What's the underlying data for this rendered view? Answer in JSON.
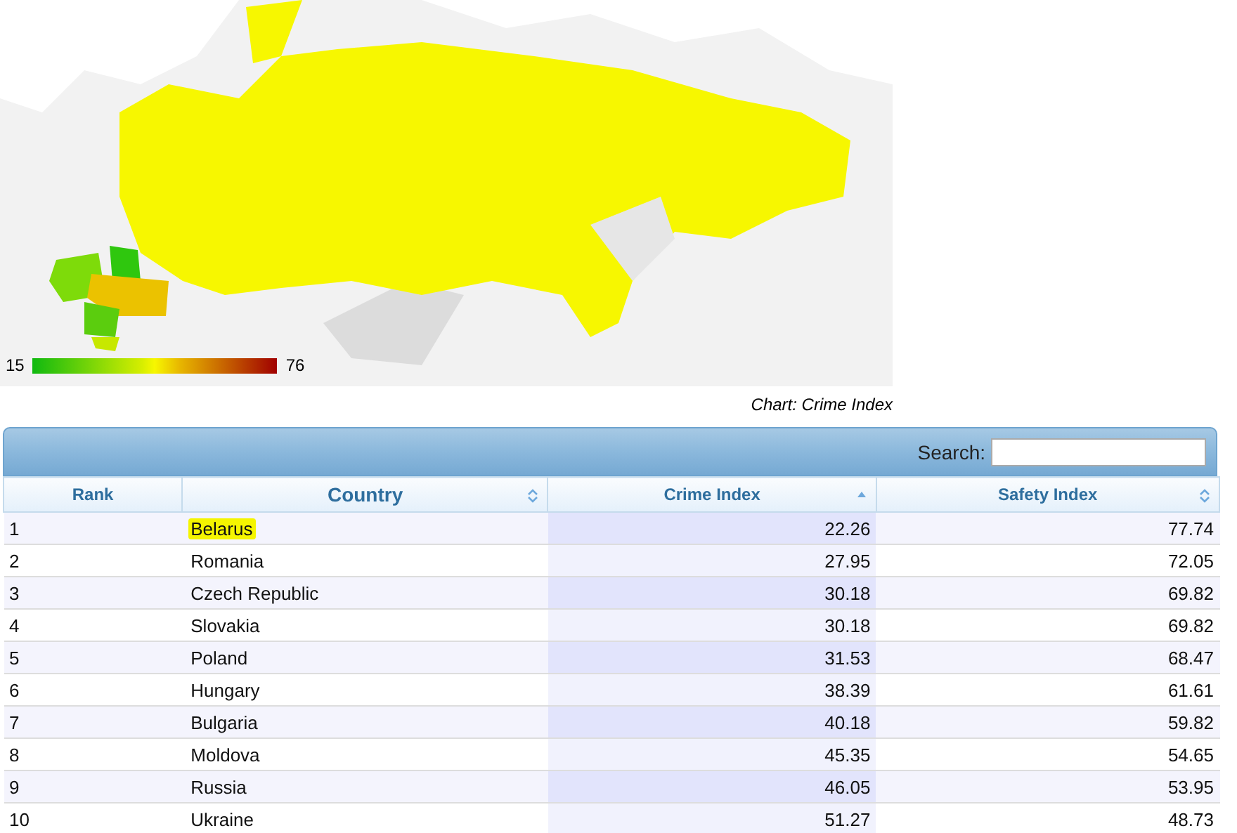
{
  "map": {
    "legend": {
      "min": "15",
      "max": "76"
    },
    "caption": "Chart: Crime Index"
  },
  "table": {
    "search": {
      "label": "Search:"
    },
    "columns": [
      {
        "label": "Rank",
        "sorted": false,
        "sortable": false
      },
      {
        "label": "Country",
        "sorted": false,
        "sortable": true
      },
      {
        "label": "Crime Index",
        "sorted": true,
        "sortable": true
      },
      {
        "label": "Safety Index",
        "sorted": false,
        "sortable": true
      }
    ],
    "rows": [
      {
        "rank": "1",
        "country": "Belarus",
        "highlighted": true,
        "crime": "22.26",
        "safety": "77.74"
      },
      {
        "rank": "2",
        "country": "Romania",
        "highlighted": false,
        "crime": "27.95",
        "safety": "72.05"
      },
      {
        "rank": "3",
        "country": "Czech Republic",
        "highlighted": false,
        "crime": "30.18",
        "safety": "69.82"
      },
      {
        "rank": "4",
        "country": "Slovakia",
        "highlighted": false,
        "crime": "30.18",
        "safety": "69.82"
      },
      {
        "rank": "5",
        "country": "Poland",
        "highlighted": false,
        "crime": "31.53",
        "safety": "68.47"
      },
      {
        "rank": "6",
        "country": "Hungary",
        "highlighted": false,
        "crime": "38.39",
        "safety": "61.61"
      },
      {
        "rank": "7",
        "country": "Bulgaria",
        "highlighted": false,
        "crime": "40.18",
        "safety": "59.82"
      },
      {
        "rank": "8",
        "country": "Moldova",
        "highlighted": false,
        "crime": "45.35",
        "safety": "54.65"
      },
      {
        "rank": "9",
        "country": "Russia",
        "highlighted": false,
        "crime": "46.05",
        "safety": "53.95"
      },
      {
        "rank": "10",
        "country": "Ukraine",
        "highlighted": false,
        "crime": "51.27",
        "safety": "48.73"
      }
    ]
  }
}
